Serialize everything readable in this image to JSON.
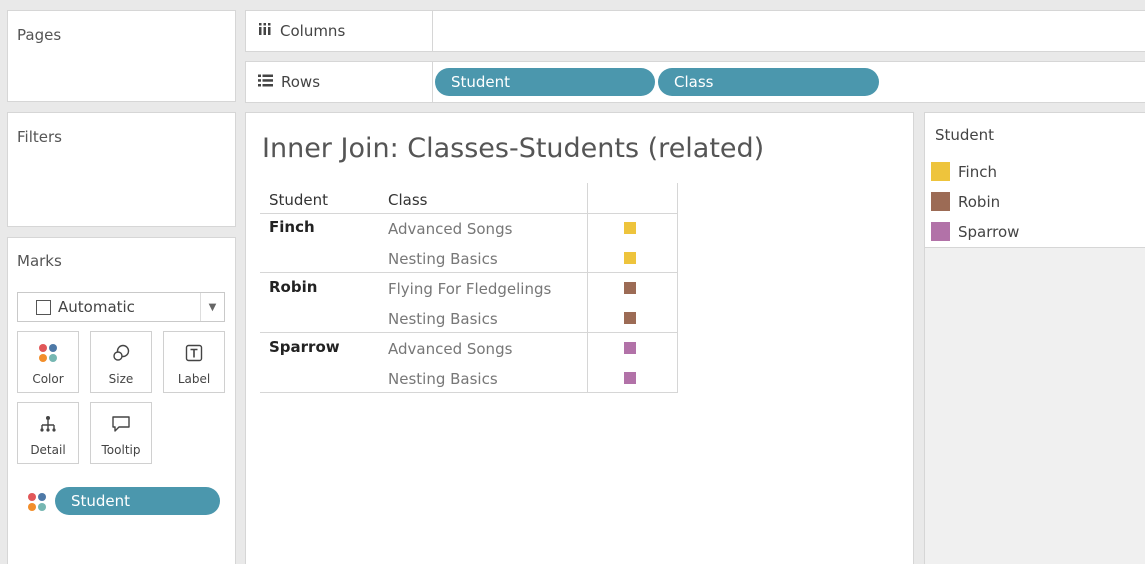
{
  "pages": {
    "title": "Pages"
  },
  "filters": {
    "title": "Filters"
  },
  "marks": {
    "title": "Marks",
    "mark_type": "Automatic",
    "buttons": {
      "color": "Color",
      "size": "Size",
      "label": "Label",
      "detail": "Detail",
      "tooltip": "Tooltip"
    },
    "field_pill": "Student"
  },
  "shelves": {
    "columns_label": "Columns",
    "rows_label": "Rows",
    "rows_pills": [
      "Student",
      "Class"
    ]
  },
  "view": {
    "title": "Inner Join: Classes-Students (related)",
    "headers": {
      "student": "Student",
      "class": "Class"
    },
    "rows": [
      {
        "student": "Finch",
        "class": "Advanced Songs",
        "color": "#eec43c"
      },
      {
        "student": "",
        "class": "Nesting Basics",
        "color": "#eec43c"
      },
      {
        "student": "Robin",
        "class": "Flying For Fledgelings",
        "color": "#9c6b55"
      },
      {
        "student": "",
        "class": "Nesting Basics",
        "color": "#9c6b55"
      },
      {
        "student": "Sparrow",
        "class": "Advanced Songs",
        "color": "#b272a8"
      },
      {
        "student": "",
        "class": "Nesting Basics",
        "color": "#b272a8"
      }
    ]
  },
  "legend": {
    "title": "Student",
    "items": [
      {
        "label": "Finch",
        "color": "#eec43c"
      },
      {
        "label": "Robin",
        "color": "#9c6b55"
      },
      {
        "label": "Sparrow",
        "color": "#b272a8"
      }
    ]
  },
  "icons": {
    "columns": "columns-icon",
    "rows": "rows-icon",
    "color": "color-dots-icon",
    "size": "size-icon",
    "label": "label-icon",
    "detail": "detail-icon",
    "tooltip": "tooltip-icon"
  },
  "colors": {
    "pill": "#4b97ad"
  }
}
